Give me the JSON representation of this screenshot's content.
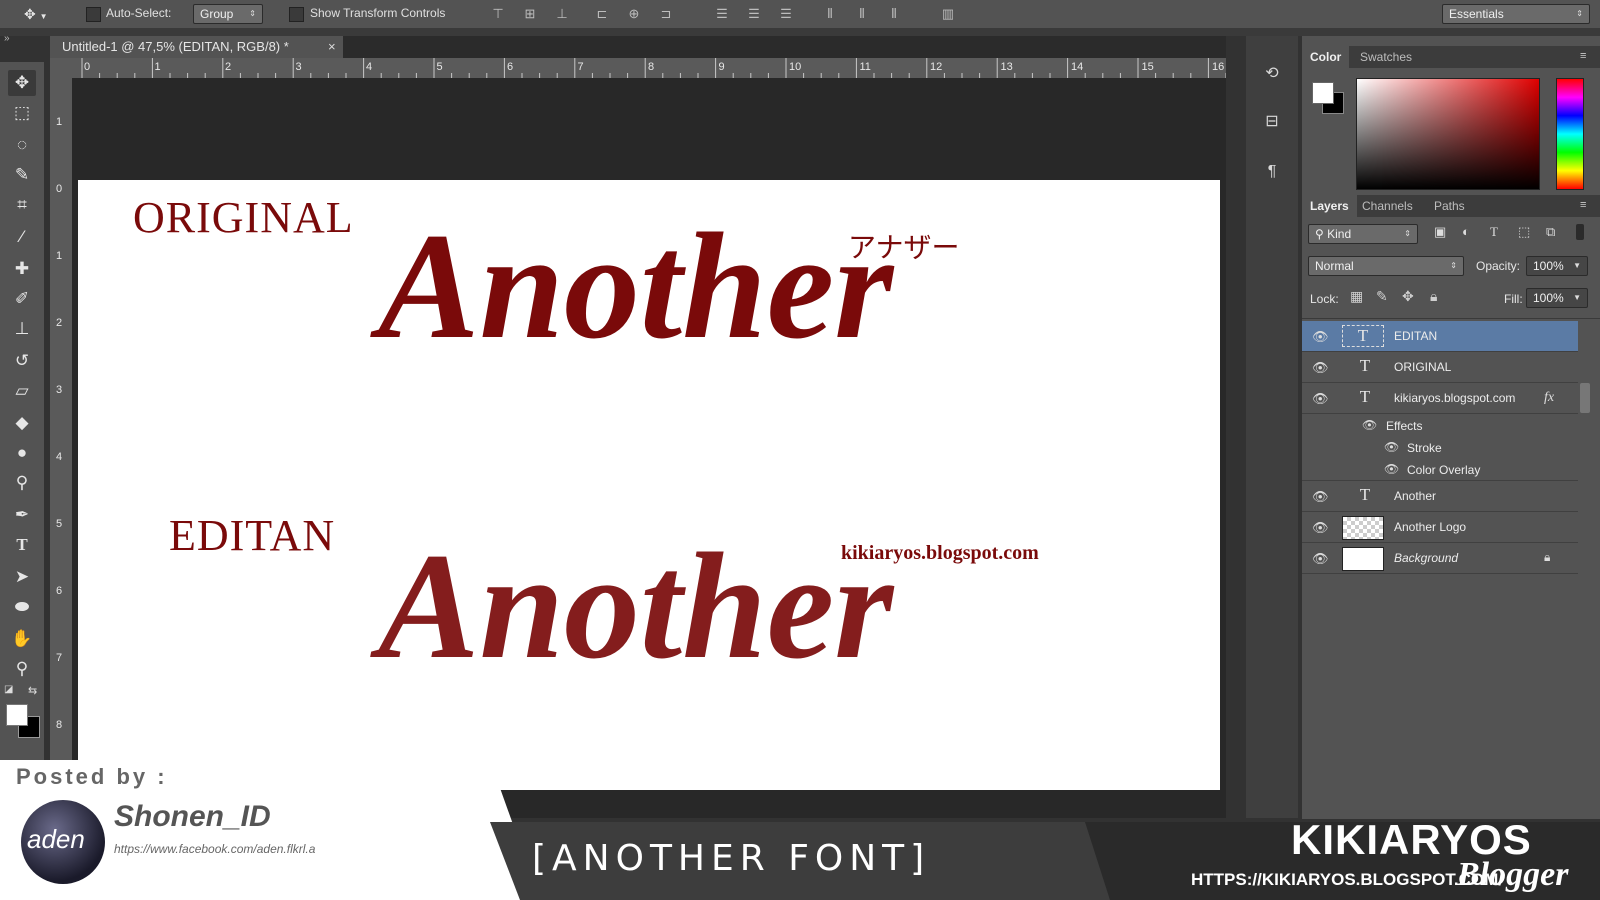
{
  "options_bar": {
    "auto_select_label": "Auto-Select:",
    "auto_select_value": "Group",
    "transform_label": "Show Transform Controls",
    "workspace_value": "Essentials"
  },
  "document": {
    "tab_title": "Untitled-1 @ 47,5% (EDITAN, RGB/8) *",
    "close_glyph": "×",
    "ruler_top": [
      "0",
      "1",
      "2",
      "3",
      "4",
      "5",
      "6",
      "7",
      "8",
      "9",
      "10",
      "11",
      "12",
      "13",
      "14",
      "15",
      "16"
    ],
    "ruler_left": [
      "1",
      "0",
      "1",
      "2",
      "3",
      "4",
      "5",
      "6",
      "7",
      "8"
    ]
  },
  "canvas": {
    "original_label": "ORIGINAL",
    "editan_label": "EDITAN",
    "title_word_top": "Another",
    "title_word_bottom": "Another",
    "katakana": "アナザー",
    "blog_watermark": "kikiaryos.blogspot.com"
  },
  "color_panel": {
    "tabs": [
      "Color",
      "Swatches"
    ],
    "foreground": "#ffffff",
    "background": "#000000"
  },
  "layers_panel": {
    "tabs": [
      "Layers",
      "Channels",
      "Paths"
    ],
    "filter_label": "Kind",
    "blend_mode": "Normal",
    "opacity_label": "Opacity:",
    "opacity_value": "100%",
    "lock_label": "Lock:",
    "fill_label": "Fill:",
    "fill_value": "100%",
    "layers": [
      {
        "name": "EDITAN",
        "type": "text",
        "selected": true
      },
      {
        "name": "ORIGINAL",
        "type": "text"
      },
      {
        "name": "kikiaryos.blogspot.com",
        "type": "text",
        "fx": "fx"
      },
      {
        "name": "Another",
        "type": "text"
      },
      {
        "name": "Another Logo",
        "type": "image"
      },
      {
        "name": "Background",
        "type": "image",
        "locked": true
      }
    ],
    "effects_label": "Effects",
    "effects": [
      "Stroke",
      "Color Overlay"
    ]
  },
  "footer": {
    "posted_by": "Posted by :",
    "avatar_text": "aden",
    "author": "Shonen_ID",
    "author_url": "https://www.facebook.com/aden.flkrl.a",
    "title": "[ANOTHER FONT]",
    "brand": "KIKIARYOS",
    "brand_url": "HTTPS://KIKIARYOS.BLOGSPOT.COM/",
    "brand_tag": "Blogger"
  },
  "colors": {
    "accent_red": "#7a0a0a",
    "selected_layer": "#5b7ba5",
    "ui_dark": "#323232"
  }
}
